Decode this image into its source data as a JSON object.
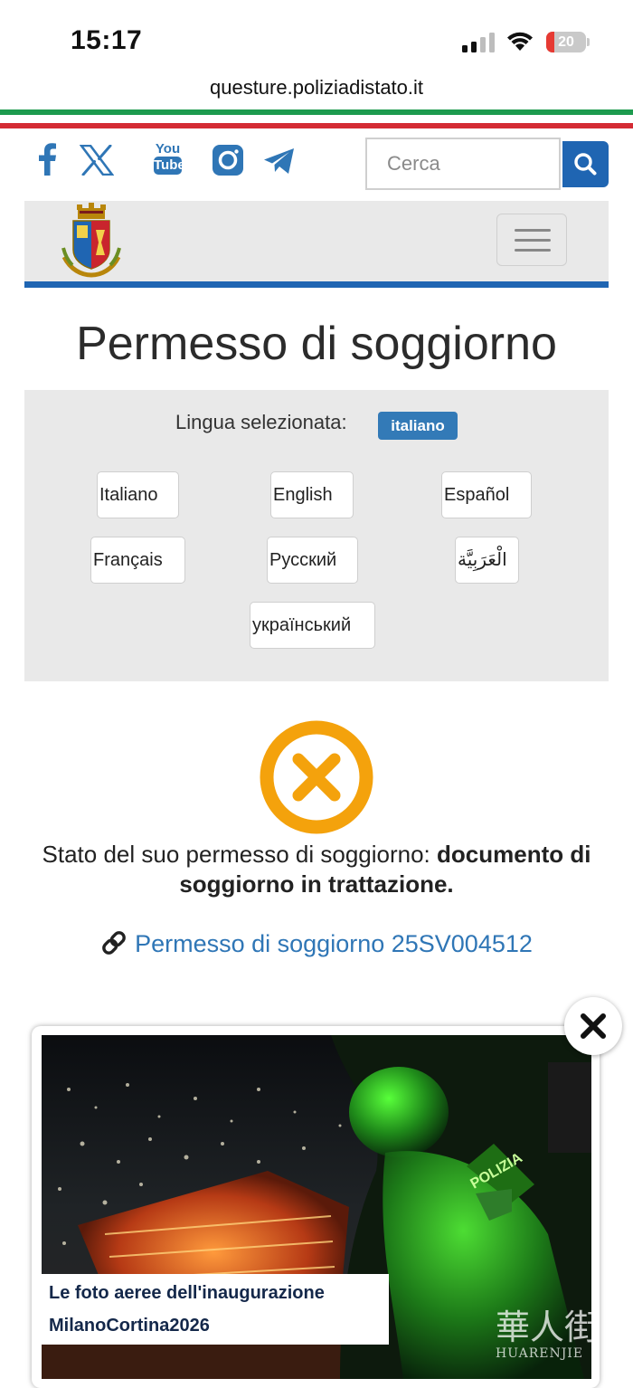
{
  "status_bar": {
    "time": "15:17",
    "battery_percent": "20",
    "battery_level": 0.2
  },
  "browser": {
    "url": "questure.poliziadistato.it"
  },
  "colors": {
    "flag_green": "#1d9b4e",
    "flag_red": "#d42b34",
    "accent_blue": "#1f65b2",
    "badge_blue": "#337ab7",
    "error_orange": "#f4a20c",
    "link_blue": "#2f76b6"
  },
  "social": {
    "icons": [
      "facebook-icon",
      "x-twitter-icon",
      "youtube-icon",
      "instagram-icon",
      "telegram-icon"
    ],
    "youtube_top": "You",
    "youtube_bottom": "Tube"
  },
  "search": {
    "placeholder": "Cerca"
  },
  "page": {
    "title": "Permesso di soggiorno"
  },
  "language": {
    "selected_label": "Lingua selezionata:",
    "selected_value": "italiano",
    "options": [
      "Italiano",
      "English",
      "Español",
      "Français",
      "Русский",
      "الْعَرَبِيَّة",
      "український"
    ]
  },
  "status": {
    "prefix": "Stato del suo permesso di soggiorno: ",
    "value": "documento di soggiorno in trattazione.",
    "link_text": "Permesso di soggiorno 25SV004512"
  },
  "popup": {
    "caption_line1": "Le foto aeree dell'inaugurazione",
    "caption_line2": "MilanoCortina2026",
    "badge_text": "POLIZIA",
    "watermark_text": "HUARENJIE"
  }
}
